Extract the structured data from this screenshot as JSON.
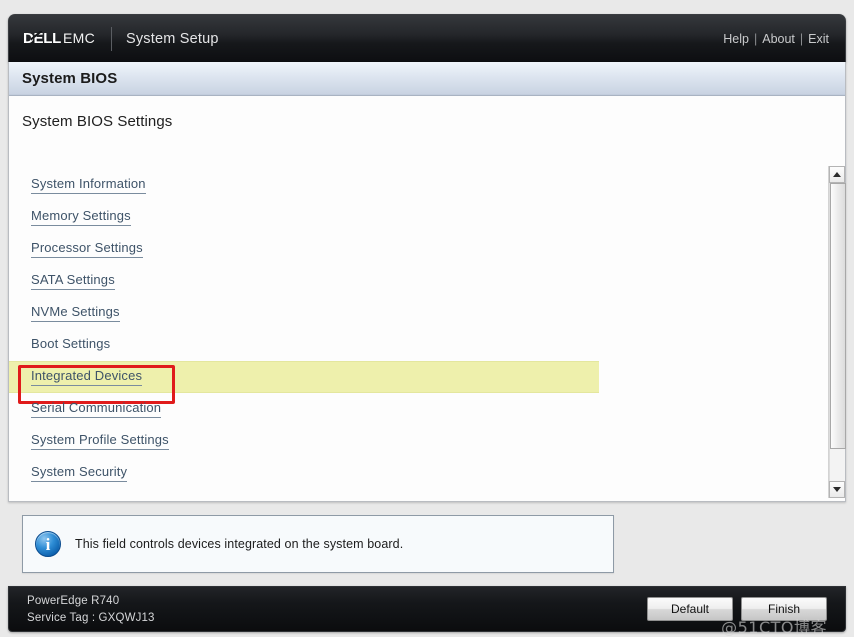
{
  "topbar": {
    "logo_dell": "DØLL",
    "logo_emc": "EMC",
    "app_title": "System Setup",
    "links": [
      {
        "label": "Help",
        "name": "help-link"
      },
      {
        "label": "About",
        "name": "about-link"
      },
      {
        "label": "Exit",
        "name": "exit-link"
      }
    ],
    "separator": "|"
  },
  "page": {
    "section_title": "System BIOS",
    "subtitle": "System BIOS Settings"
  },
  "menu": {
    "items": [
      {
        "label": "System Information",
        "underline": true,
        "highlighted": false
      },
      {
        "label": "Memory Settings",
        "underline": true,
        "highlighted": false
      },
      {
        "label": "Processor Settings",
        "underline": true,
        "highlighted": false
      },
      {
        "label": "SATA Settings",
        "underline": true,
        "highlighted": false
      },
      {
        "label": "NVMe Settings",
        "underline": true,
        "highlighted": false
      },
      {
        "label": "Boot Settings",
        "underline": false,
        "highlighted": false
      },
      {
        "label": "Integrated Devices",
        "underline": true,
        "highlighted": true
      },
      {
        "label": "Serial Communication",
        "underline": true,
        "highlighted": false
      },
      {
        "label": "System Profile Settings",
        "underline": true,
        "highlighted": false
      },
      {
        "label": "System Security",
        "underline": true,
        "highlighted": false
      }
    ]
  },
  "scrollbar": {
    "up_arrow": "▲",
    "down_arrow": "▼"
  },
  "info": {
    "icon": "i",
    "text": "This field controls devices integrated on the system board."
  },
  "footer": {
    "model": "PowerEdge R740",
    "service_tag": "Service Tag : GXQWJ13",
    "default_label": "Default",
    "finish_label": "Finish"
  },
  "watermark": {
    "text": "@51CTO博客"
  },
  "colors": {
    "highlight_bg": "#eef0ac",
    "annotation_red": "#e01b1b",
    "link_text": "#3e5368",
    "header_dark": "#16181b",
    "info_icon_blue": "#0c60ad"
  }
}
